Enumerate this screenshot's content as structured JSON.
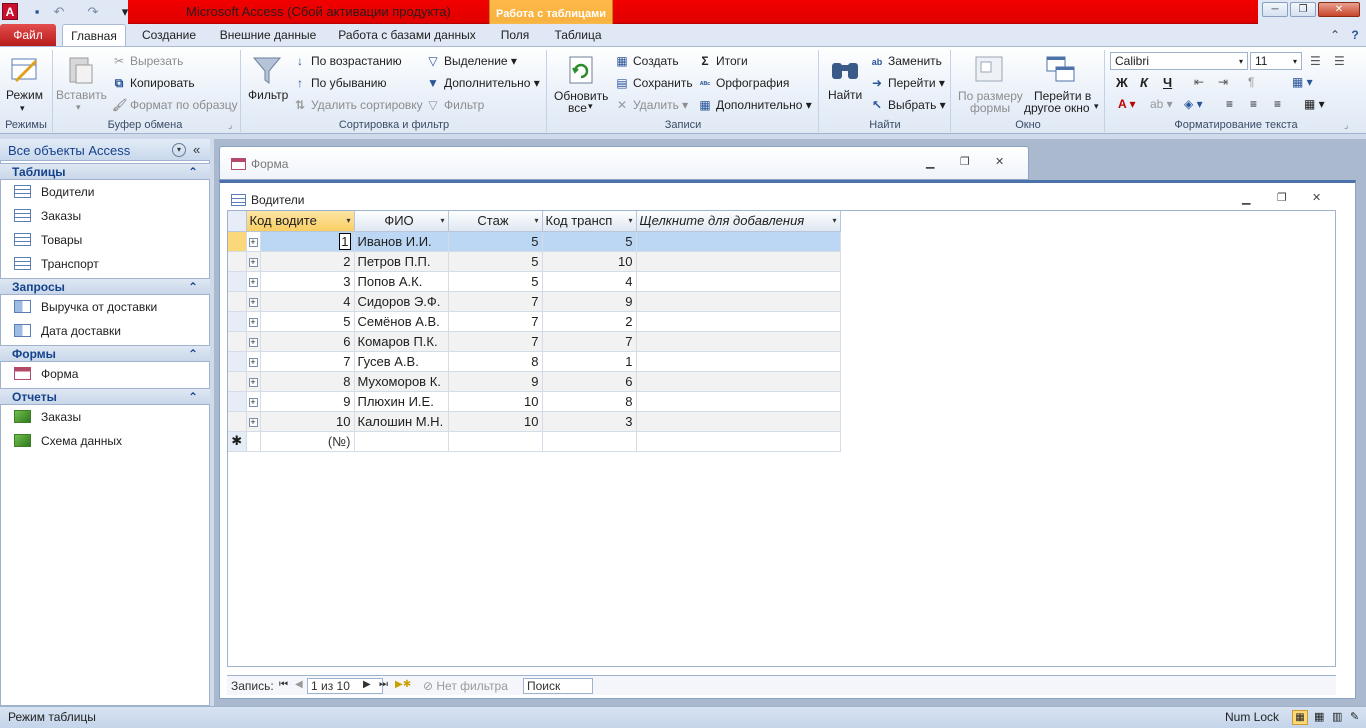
{
  "window": {
    "title": "Microsoft Access (Сбой активации продукта)",
    "context_tab_group": "Работа с таблицами",
    "minimize_icon": "─",
    "restore_icon": "❐",
    "close_icon": "✕"
  },
  "quick_access": {
    "app_icon": "A",
    "save_icon": "💾",
    "undo_icon": "↶",
    "redo_icon": "↷",
    "customize_icon": "▾"
  },
  "ribbon": {
    "tabs": [
      "Файл",
      "Главная",
      "Создание",
      "Внешние данные",
      "Работа с базами данных",
      "Поля",
      "Таблица"
    ],
    "help_icon": "?",
    "collapse_icon": "⌃",
    "groups": {
      "views": {
        "label": "Режимы",
        "view_button": "Режим"
      },
      "clipboard": {
        "label": "Буфер обмена",
        "paste": "Вставить",
        "cut": "Вырезать",
        "copy": "Копировать",
        "format_painter": "Формат по образцу"
      },
      "sort_filter": {
        "label": "Сортировка и фильтр",
        "filter": "Фильтр",
        "ascending": "По возрастанию",
        "descending": "По убыванию",
        "clear_sort": "Удалить сортировку",
        "selection": "Выделение",
        "advanced": "Дополнительно",
        "toggle_filter": "Фильтр"
      },
      "records": {
        "label": "Записи",
        "refresh_line1": "Обновить",
        "refresh_line2": "все",
        "new": "Создать",
        "save": "Сохранить",
        "delete": "Удалить",
        "totals": "Итоги",
        "spelling": "Орфография",
        "more": "Дополнительно"
      },
      "find": {
        "label": "Найти",
        "find": "Найти",
        "replace": "Заменить",
        "goto": "Перейти",
        "select": "Выбрать"
      },
      "window": {
        "label": "Окно",
        "fit_form_line1": "По размеру",
        "fit_form_line2": "формы",
        "switch_line1": "Перейти в",
        "switch_line2": "другое окно"
      },
      "text_format": {
        "label": "Форматирование текста",
        "font": "Calibri",
        "size": "11",
        "bold": "Ж",
        "italic": "К",
        "underline": "Ч"
      }
    }
  },
  "nav_pane": {
    "title": "Все объекты Access",
    "groups": [
      {
        "name": "Таблицы",
        "items": [
          "Водители",
          "Заказы",
          "Товары",
          "Транспорт"
        ]
      },
      {
        "name": "Запросы",
        "items": [
          "Выручка от доставки",
          "Дата доставки"
        ]
      },
      {
        "name": "Формы",
        "items": [
          "Форма"
        ]
      },
      {
        "name": "Отчеты",
        "items": [
          "Заказы",
          "Схема данных"
        ]
      }
    ]
  },
  "form_window": {
    "title": "Форма"
  },
  "datasheet": {
    "title": "Водители",
    "columns": [
      "Код водите",
      "ФИО",
      "Стаж",
      "Код трансп",
      "Щелкните для добавления"
    ],
    "rows": [
      [
        "1",
        "Иванов И.И.",
        "5",
        "5"
      ],
      [
        "2",
        "Петров П.П.",
        "5",
        "10"
      ],
      [
        "3",
        "Попов А.К.",
        "5",
        "4"
      ],
      [
        "4",
        "Сидоров Э.Ф.",
        "7",
        "9"
      ],
      [
        "5",
        "Семёнов А.В.",
        "7",
        "2"
      ],
      [
        "6",
        "Комаров П.К.",
        "7",
        "7"
      ],
      [
        "7",
        "Гусев А.В.",
        "8",
        "1"
      ],
      [
        "8",
        "Мухоморов К.",
        "9",
        "6"
      ],
      [
        "9",
        "Плюхин И.Е.",
        "10",
        "8"
      ],
      [
        "10",
        "Калошин М.Н.",
        "10",
        "3"
      ]
    ],
    "new_row": "(№)",
    "new_row_marker": "✱"
  },
  "record_nav": {
    "label": "Запись:",
    "position": "1 из 10",
    "no_filter": "Нет фильтра",
    "search": "Поиск"
  },
  "status_bar": {
    "mode": "Режим таблицы",
    "num_lock": "Num Lock"
  },
  "colors": {
    "title_red": "#e00000",
    "context_orange": "#f7b23f",
    "selected_row": "#bcd7f3",
    "sorted_header": "#f9cf64"
  }
}
